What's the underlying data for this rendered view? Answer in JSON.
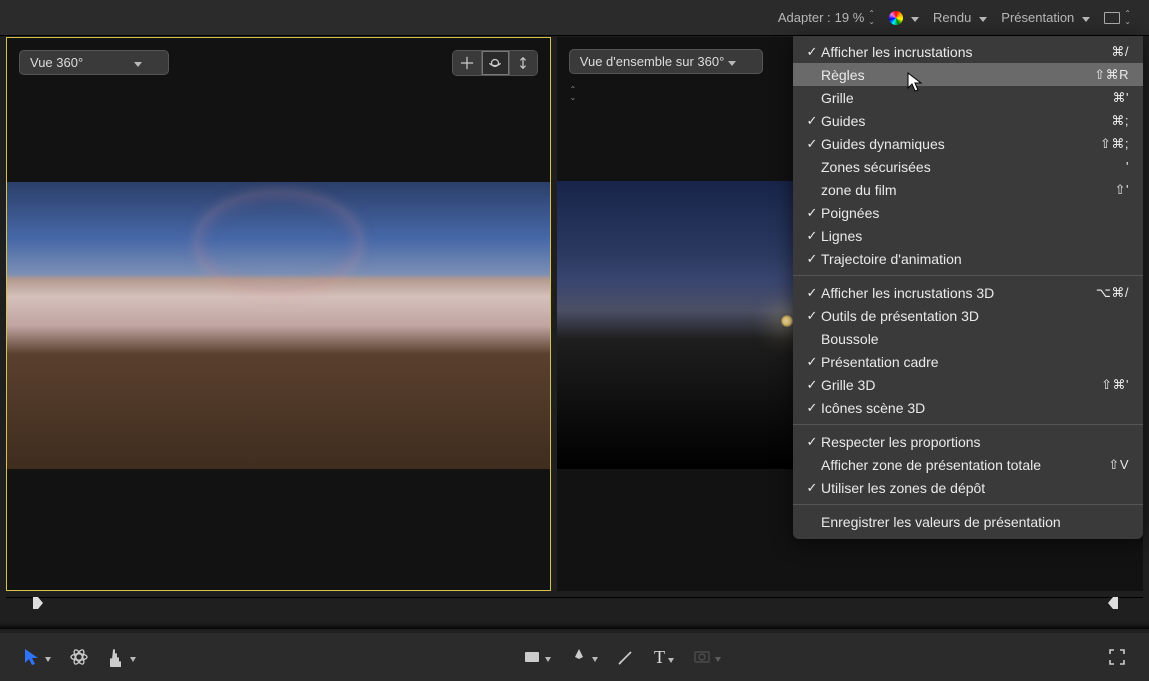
{
  "topbar": {
    "adapter_label": "Adapter :",
    "adapter_value": "19 %",
    "rendu_label": "Rendu",
    "presentation_label": "Présentation"
  },
  "viewer_left": {
    "selector_label": "Vue 360°"
  },
  "viewer_right": {
    "selector_label": "Vue d'ensemble sur 360°"
  },
  "menu": {
    "section1": [
      {
        "check": true,
        "label": "Afficher les incrustations",
        "shortcut": "⌘/"
      },
      {
        "check": false,
        "label": "Règles",
        "shortcut": "⇧⌘R",
        "highlight": true
      },
      {
        "check": false,
        "label": "Grille",
        "shortcut": "⌘'"
      },
      {
        "check": true,
        "label": "Guides",
        "shortcut": "⌘;"
      },
      {
        "check": true,
        "label": "Guides dynamiques",
        "shortcut": "⇧⌘;"
      },
      {
        "check": false,
        "label": "Zones sécurisées",
        "shortcut": "'"
      },
      {
        "check": false,
        "label": "zone du film",
        "shortcut": "⇧'"
      },
      {
        "check": true,
        "label": "Poignées",
        "shortcut": ""
      },
      {
        "check": true,
        "label": "Lignes",
        "shortcut": ""
      },
      {
        "check": true,
        "label": "Trajectoire d'animation",
        "shortcut": ""
      }
    ],
    "section2": [
      {
        "check": true,
        "label": "Afficher les incrustations 3D",
        "shortcut": "⌥⌘/"
      },
      {
        "check": true,
        "label": "Outils de présentation 3D",
        "shortcut": ""
      },
      {
        "check": false,
        "label": "Boussole",
        "shortcut": ""
      },
      {
        "check": true,
        "label": "Présentation cadre",
        "shortcut": ""
      },
      {
        "check": true,
        "label": "Grille 3D",
        "shortcut": "⇧⌘'"
      },
      {
        "check": true,
        "label": "Icônes scène 3D",
        "shortcut": ""
      }
    ],
    "section3": [
      {
        "check": true,
        "label": "Respecter les proportions",
        "shortcut": ""
      },
      {
        "check": false,
        "label": "Afficher zone de présentation totale",
        "shortcut": "⇧V"
      },
      {
        "check": true,
        "label": "Utiliser les zones de dépôt",
        "shortcut": ""
      }
    ],
    "section4": [
      {
        "check": false,
        "label": "Enregistrer les valeurs de présentation",
        "shortcut": ""
      }
    ]
  },
  "bottombar": {
    "text_tool_label": "T"
  }
}
